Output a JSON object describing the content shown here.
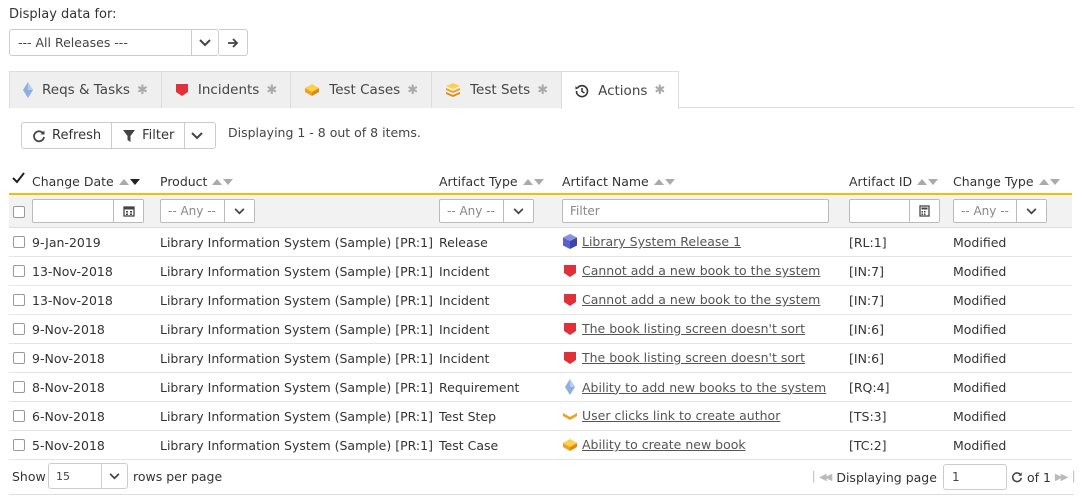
{
  "display": {
    "label": "Display data for:",
    "release_value": "--- All Releases ---"
  },
  "tabs": [
    {
      "label": "Reqs & Tasks",
      "icon": "requirement-icon",
      "active": false
    },
    {
      "label": "Incidents",
      "icon": "incident-icon",
      "active": false
    },
    {
      "label": "Test Cases",
      "icon": "test-case-icon",
      "active": false
    },
    {
      "label": "Test Sets",
      "icon": "test-set-icon",
      "active": false
    },
    {
      "label": "Actions",
      "icon": "history-icon",
      "active": true
    }
  ],
  "tab_star": "✱",
  "toolbar": {
    "refresh_label": "Refresh",
    "filter_label": "Filter",
    "count_text": "Displaying 1 - 8 out of 8 items."
  },
  "columns": {
    "change_date": "Change Date",
    "product": "Product",
    "artifact_type": "Artifact Type",
    "artifact_name": "Artifact Name",
    "artifact_id": "Artifact ID",
    "change_type": "Change Type"
  },
  "filters": {
    "any": "-- Any --",
    "name_placeholder": "Filter"
  },
  "rows": [
    {
      "date": "9-Jan-2019",
      "product": "Library Information System (Sample) [PR:1]",
      "type": "Release",
      "icon": "release-icon",
      "name": "Library System Release 1",
      "id": "[RL:1]",
      "change": "Modified"
    },
    {
      "date": "13-Nov-2018",
      "product": "Library Information System (Sample) [PR:1]",
      "type": "Incident",
      "icon": "incident-icon",
      "name": "Cannot add a new book to the system",
      "id": "[IN:7]",
      "change": "Modified"
    },
    {
      "date": "13-Nov-2018",
      "product": "Library Information System (Sample) [PR:1]",
      "type": "Incident",
      "icon": "incident-icon",
      "name": "Cannot add a new book to the system",
      "id": "[IN:7]",
      "change": "Modified"
    },
    {
      "date": "9-Nov-2018",
      "product": "Library Information System (Sample) [PR:1]",
      "type": "Incident",
      "icon": "incident-icon",
      "name": "The book listing screen doesn't sort",
      "id": "[IN:6]",
      "change": "Modified"
    },
    {
      "date": "9-Nov-2018",
      "product": "Library Information System (Sample) [PR:1]",
      "type": "Incident",
      "icon": "incident-icon",
      "name": "The book listing screen doesn't sort",
      "id": "[IN:6]",
      "change": "Modified"
    },
    {
      "date": "8-Nov-2018",
      "product": "Library Information System (Sample) [PR:1]",
      "type": "Requirement",
      "icon": "requirement-icon",
      "name": "Ability to add new books to the system",
      "id": "[RQ:4]",
      "change": "Modified"
    },
    {
      "date": "6-Nov-2018",
      "product": "Library Information System (Sample) [PR:1]",
      "type": "Test Step",
      "icon": "test-step-icon",
      "name": "User clicks link to create author",
      "id": "[TS:3]",
      "change": "Modified"
    },
    {
      "date": "5-Nov-2018",
      "product": "Library Information System (Sample) [PR:1]",
      "type": "Test Case",
      "icon": "test-case-icon",
      "name": "Ability to create new book",
      "id": "[TC:2]",
      "change": "Modified"
    }
  ],
  "footer": {
    "show_label": "Show",
    "page_size": "15",
    "rows_per_page": "rows per page",
    "displaying_page": "Displaying page",
    "page_value": "1",
    "of_text": "of 1"
  }
}
